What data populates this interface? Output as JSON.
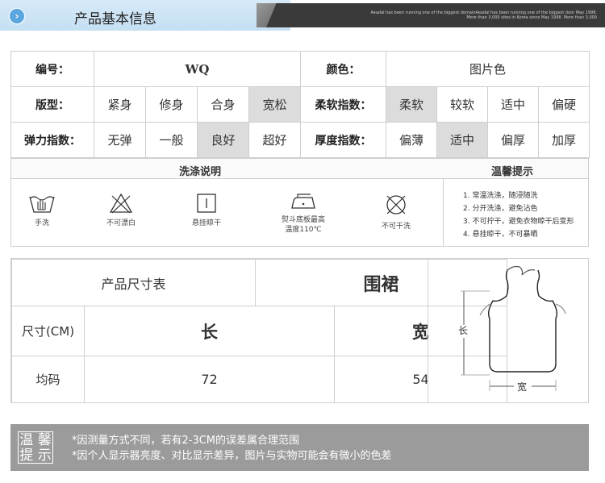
{
  "header": {
    "title": "产品基本信息",
    "ribbon_text": "Aeadal has been running one of the biggest domainAeadal has been running one of the biggest door May 1998. More than 3,000 sites in Korea since May 1998. More than 3,000"
  },
  "info": {
    "number_label": "编号：",
    "number_value": "WQ",
    "color_label": "颜色：",
    "color_value": "图片色",
    "fit_label": "版型：",
    "fit_options": [
      "紧身",
      "修身",
      "合身",
      "宽松"
    ],
    "fit_selected": "宽松",
    "softness_label": "柔软指数：",
    "softness_options": [
      "柔软",
      "较软",
      "适中",
      "偏硬"
    ],
    "softness_selected": "柔软",
    "stretch_label": "弹力指数：",
    "stretch_options": [
      "无弹",
      "一般",
      "良好",
      "超好"
    ],
    "stretch_selected": "良好",
    "thickness_label": "厚度指数：",
    "thickness_options": [
      "偏薄",
      "适中",
      "偏厚",
      "加厚"
    ],
    "thickness_selected": "适中"
  },
  "wash": {
    "title": "洗涤说明",
    "tips_title": "温馨提示",
    "items": [
      {
        "icon": "hand-wash-icon",
        "caption": "手洗"
      },
      {
        "icon": "no-bleach-icon",
        "caption": "不可漂白"
      },
      {
        "icon": "hang-dry-icon",
        "caption": "悬挂晾干"
      },
      {
        "icon": "iron-icon",
        "caption": "熨斗底板最高温度110℃"
      },
      {
        "icon": "no-dry-clean-icon",
        "caption": "不可干洗"
      }
    ],
    "iron_caption_line1": "熨斗底板最高",
    "iron_caption_line2": "温度110℃",
    "tips": [
      "1. 常温洗涤，随浸随洗",
      "2. 分开洗涤，避免沾色",
      "3. 不可拧干，避免衣物晾干后变形",
      "4. 悬挂晾干，不可暴晒"
    ]
  },
  "size": {
    "title": "产品尺寸表",
    "product": "围裙",
    "size_label": "尺寸(CM)",
    "col_length": "长",
    "col_width": "宽",
    "row_label": "均码",
    "length_value": "72",
    "width_value": "54",
    "diagram_length": "长",
    "diagram_width": "宽"
  },
  "note": {
    "badge_line1": "温 馨",
    "badge_line2": "提 示",
    "lines": [
      "*因测量方式不同，若有2-3CM的误差属合理范围",
      "*因个人显示器亮度、对比显示差异，图片与实物可能会有微小的色差"
    ]
  },
  "colors": {
    "header_bg": "#c5dff3",
    "accent": "#5aa6de",
    "highlight_cell": "#dcdcdc",
    "note_bg": "#9b9b9b"
  }
}
